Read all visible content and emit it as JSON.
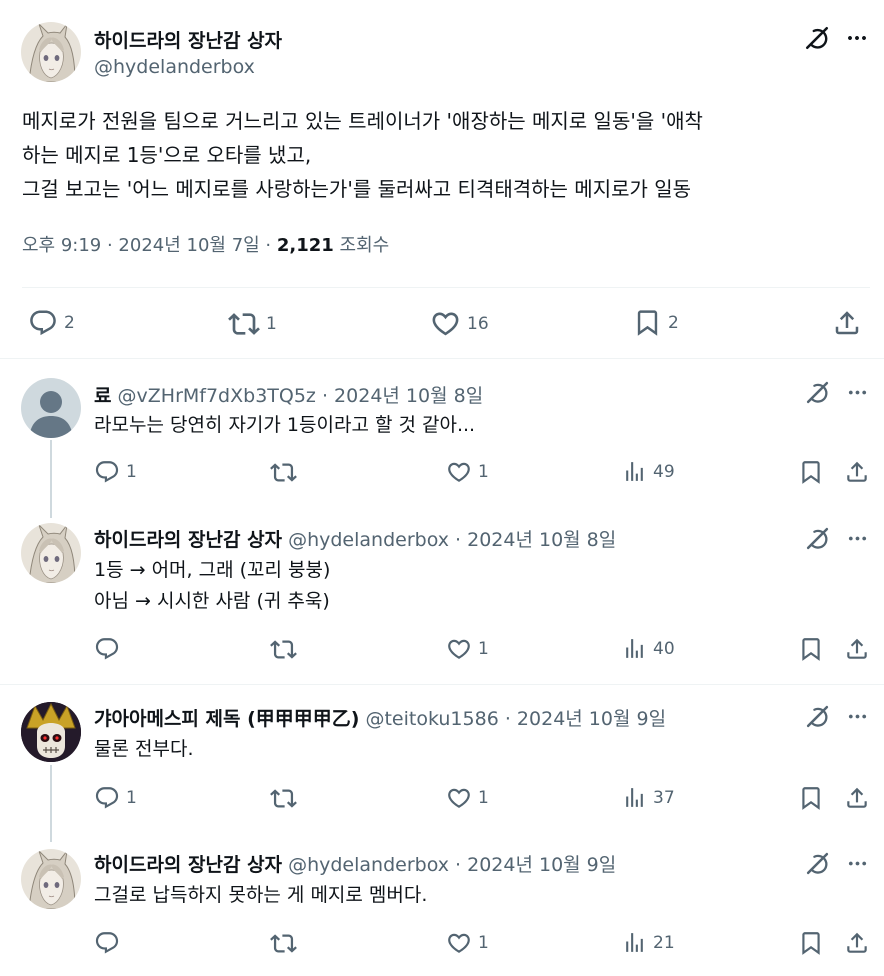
{
  "main_post": {
    "author_name": "하이드라의 장난감 상자",
    "author_handle": "@hydelanderbox",
    "text": "메지로가 전원을 팀으로 거느리고 있는 트레이너가 '애장하는 메지로 일동'을 '애착\n하는 메지로 1등'으로 오타를 냈고,\n그걸 보고는 '어느 메지로를 사랑하는가'를 둘러싸고 티격태격하는 메지로가 일동",
    "time": "오후 9:19 · 2024년 10월 7일 · ",
    "views_count": "2,121",
    "views_label": " 조회수",
    "replies": "2",
    "reposts": "1",
    "likes": "16",
    "bookmarks": "2"
  },
  "replies": [
    {
      "author_name": "료",
      "author_handle": "@vZHrMf7dXb3TQ5z",
      "date": "· 2024년 10월 8일",
      "text": "라모누는 당연히 자기가 1등이라고 할 것 같아...",
      "replies": "1",
      "reposts": "",
      "likes": "1",
      "views": "49"
    },
    {
      "author_name": "하이드라의 장난감 상자",
      "author_handle": "@hydelanderbox",
      "date": "· 2024년 10월 8일",
      "text": "1등 → 어머, 그래 (꼬리 붕붕)\n아님 → 시시한 사람 (귀 추욱)",
      "replies": "",
      "reposts": "",
      "likes": "1",
      "views": "40"
    },
    {
      "author_name": "갸아아메스피 제독 (甲甲甲甲乙)",
      "author_handle": "@teitoku1586",
      "date": "· 2024년 10월 9일",
      "text": "물론 전부다.",
      "replies": "1",
      "reposts": "",
      "likes": "1",
      "views": "37"
    },
    {
      "author_name": "하이드라의 장난감 상자",
      "author_handle": "@hydelanderbox",
      "date": "· 2024년 10월 9일",
      "text": "그걸로 납득하지 못하는 게 메지로 멤버다.",
      "replies": "",
      "reposts": "",
      "likes": "1",
      "views": "21"
    }
  ],
  "colors": {
    "text": "#0f1419",
    "secondary": "#536471",
    "border": "#eff3f4",
    "thread_line": "#cfd9de"
  }
}
